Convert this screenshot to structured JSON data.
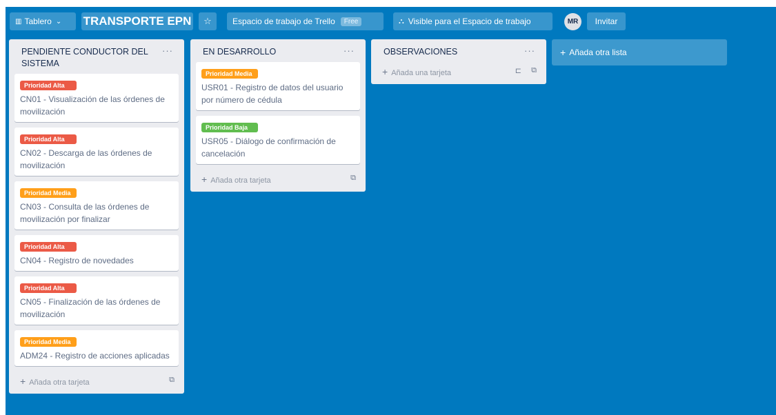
{
  "header": {
    "board_button": {
      "icon": "board-icon",
      "label": "Tablero"
    },
    "title": "TRANSPORTE EPN",
    "workspace": {
      "label": "Espacio de trabajo de Trello",
      "badge": "Free"
    },
    "visibility": {
      "label": "Visible para el Espacio de trabajo"
    },
    "avatar": "MR",
    "invite": "Invitar"
  },
  "lists": [
    {
      "title": "PENDIENTE CONDUCTOR DEL SISTEMA",
      "menu": "···",
      "cards": [
        {
          "label": "Prioridad Alta",
          "title": "CN01 - Visualización de las órdenes de movilización"
        },
        {
          "label": "Prioridad Alta",
          "title": "CN02 - Descarga de las órdenes de movilización"
        },
        {
          "label": "Prioridad Media",
          "title": "CN03 - Consulta de las órdenes de movilización por finalizar"
        },
        {
          "label": "Prioridad Alta",
          "title": "CN04 - Registro de novedades"
        },
        {
          "label": "Prioridad Alta",
          "title": "CN05 - Finalización de las órdenes de movilización"
        },
        {
          "label": "Prioridad Media",
          "title": "ADM24 - Registro de acciones aplicadas"
        }
      ],
      "add_card": "Añada otra tarjeta"
    },
    {
      "title": "EN DESARROLLO",
      "menu": "···",
      "cards": [
        {
          "label": "Prioridad Media",
          "title": "USR01 - Registro de datos del usuario por número de cédula"
        },
        {
          "label": "Prioridad Baja",
          "title": "USR05 - Diálogo de confirmación de cancelación"
        }
      ],
      "add_card": "Añada otra tarjeta"
    },
    {
      "title": "OBSERVACIONES",
      "menu": "···",
      "cards": [],
      "add_card": "Añada una tarjeta"
    }
  ],
  "add_list": "Añada otra lista",
  "colors": {
    "board_bg": "#0079bf",
    "label_alta": "#eb5a46",
    "label_media": "#ff9f1a",
    "label_baja": "#61bd4f"
  }
}
